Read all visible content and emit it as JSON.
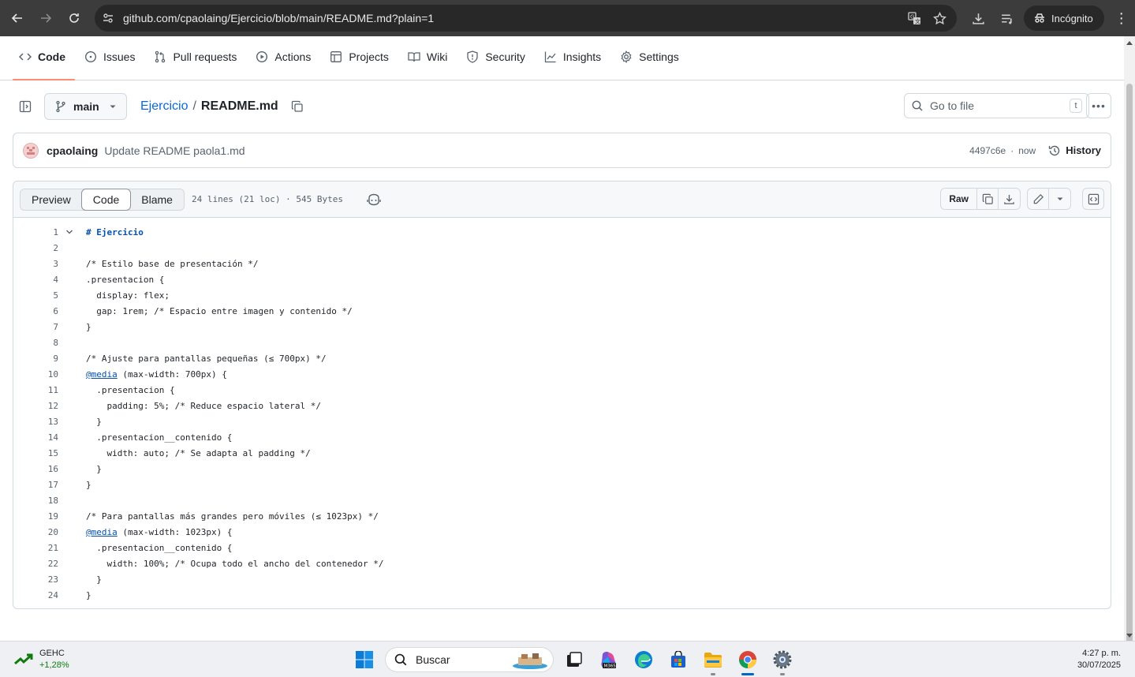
{
  "browser": {
    "url": "github.com/cpaolaing/Ejercicio/blob/main/README.md?plain=1",
    "incognito_label": "Incógnito"
  },
  "repo_nav": {
    "tabs": [
      {
        "label": "Code",
        "active": true
      },
      {
        "label": "Issues"
      },
      {
        "label": "Pull requests"
      },
      {
        "label": "Actions"
      },
      {
        "label": "Projects"
      },
      {
        "label": "Wiki"
      },
      {
        "label": "Security"
      },
      {
        "label": "Insights"
      },
      {
        "label": "Settings"
      }
    ]
  },
  "file_header": {
    "branch": "main",
    "repo": "Ejercicio",
    "separator": "/",
    "file": "README.md",
    "goto_placeholder": "Go to file",
    "goto_shortcut": "t"
  },
  "commit": {
    "author": "cpaolaing",
    "message": "Update README paola1.md",
    "sha": "4497c6e",
    "dot": "·",
    "time": "now",
    "history_label": "History"
  },
  "file_toolbar": {
    "views": [
      "Preview",
      "Code",
      "Blame"
    ],
    "active_view": "Code",
    "meta": "24 lines (21 loc) · 545 Bytes",
    "raw_label": "Raw"
  },
  "code_lines": [
    "# Ejercicio",
    "",
    "/* Estilo base de presentación */",
    ".presentacion {",
    "  display: flex;",
    "  gap: 1rem; /* Espacio entre imagen y contenido */",
    "}",
    "",
    "/* Ajuste para pantallas pequeñas (≤ 700px) */",
    "@media (max-width: 700px) {",
    "  .presentacion {",
    "    padding: 5%; /* Reduce espacio lateral */",
    "  }",
    "  .presentacion__contenido {",
    "    width: auto; /* Se adapta al padding */",
    "  }",
    "}",
    "",
    "/* Para pantallas más grandes pero móviles (≤ 1023px) */",
    "@media (max-width: 1023px) {",
    "  .presentacion__contenido {",
    "    width: 100%; /* Ocupa todo el ancho del contenedor */",
    "  }",
    "}"
  ],
  "taskbar": {
    "stock_name": "GEHC",
    "stock_change": "+1,28%",
    "search_placeholder": "Buscar",
    "time": "4:27 p. m.",
    "date": "30/07/2025"
  }
}
